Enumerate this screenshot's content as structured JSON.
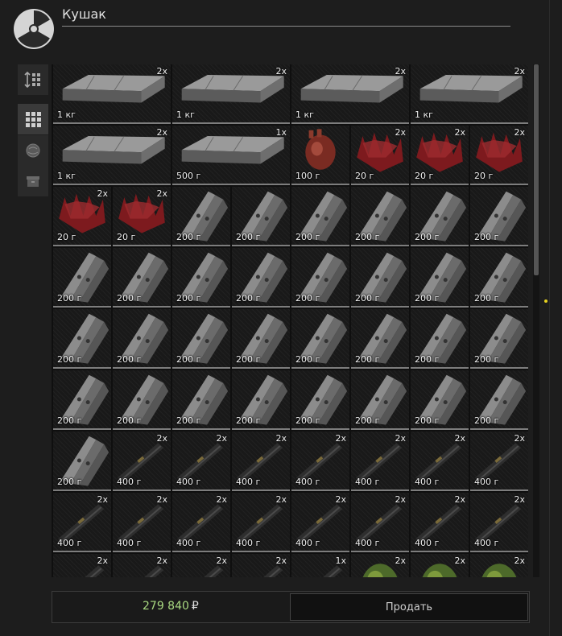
{
  "header": {
    "title": "Кушак",
    "logo_icon": "radiation-icon"
  },
  "sidebar": {
    "tools": [
      {
        "icon": "sort-icon",
        "active": false
      },
      {
        "icon": "grid-view-icon",
        "active": true
      },
      {
        "icon": "artifact-filter-icon",
        "active": false
      },
      {
        "icon": "container-filter-icon",
        "active": false
      }
    ]
  },
  "inventory": {
    "cell_size": [
      {
        "row": 0,
        "items": [
          {
            "type": "crate",
            "span": 2,
            "count": "2x",
            "weight": "1 кг"
          },
          {
            "type": "crate",
            "span": 2,
            "count": "2x",
            "weight": "1 кг"
          },
          {
            "type": "crate",
            "span": 2,
            "count": "2x",
            "weight": "1 кг"
          },
          {
            "type": "crate",
            "span": 2,
            "count": "2x",
            "weight": "1 кг"
          }
        ]
      }
    ],
    "rows": [
      [
        {
          "type": "crate",
          "span": 2,
          "count": "2x",
          "weight": "1 кг"
        },
        {
          "type": "crate",
          "span": 2,
          "count": "2x",
          "weight": "1 кг"
        },
        {
          "type": "crate",
          "span": 2,
          "count": "2x",
          "weight": "1 кг"
        },
        {
          "type": "crate",
          "span": 2,
          "count": "2x",
          "weight": "1 кг"
        }
      ],
      [
        {
          "type": "crate",
          "span": 2,
          "count": "2x",
          "weight": "1 кг"
        },
        {
          "type": "crate",
          "span": 2,
          "count": "1x",
          "weight": "500 г"
        },
        {
          "type": "heart",
          "span": 1,
          "count": "",
          "weight": "100 г"
        },
        {
          "type": "spikes",
          "span": 1,
          "count": "2x",
          "weight": "20 г"
        },
        {
          "type": "spikes",
          "span": 1,
          "count": "2x",
          "weight": "20 г"
        },
        {
          "type": "spikes",
          "span": 1,
          "count": "2x",
          "weight": "20 г"
        }
      ],
      [
        {
          "type": "spikes",
          "span": 1,
          "count": "2x",
          "weight": "20 г"
        },
        {
          "type": "spikes",
          "span": 1,
          "count": "2x",
          "weight": "20 г"
        },
        {
          "type": "plates",
          "span": 1,
          "count": "",
          "weight": "200 г"
        },
        {
          "type": "plates",
          "span": 1,
          "count": "",
          "weight": "200 г"
        },
        {
          "type": "plates",
          "span": 1,
          "count": "",
          "weight": "200 г"
        },
        {
          "type": "plates",
          "span": 1,
          "count": "",
          "weight": "200 г"
        },
        {
          "type": "plates",
          "span": 1,
          "count": "",
          "weight": "200 г"
        },
        {
          "type": "plates",
          "span": 1,
          "count": "",
          "weight": "200 г"
        }
      ],
      [
        {
          "type": "plates",
          "span": 1,
          "count": "",
          "weight": "200 г"
        },
        {
          "type": "plates",
          "span": 1,
          "count": "",
          "weight": "200 г"
        },
        {
          "type": "plates",
          "span": 1,
          "count": "",
          "weight": "200 г"
        },
        {
          "type": "plates",
          "span": 1,
          "count": "",
          "weight": "200 г"
        },
        {
          "type": "plates",
          "span": 1,
          "count": "",
          "weight": "200 г"
        },
        {
          "type": "plates",
          "span": 1,
          "count": "",
          "weight": "200 г"
        },
        {
          "type": "plates",
          "span": 1,
          "count": "",
          "weight": "200 г"
        },
        {
          "type": "plates",
          "span": 1,
          "count": "",
          "weight": "200 г"
        }
      ],
      [
        {
          "type": "plates",
          "span": 1,
          "count": "",
          "weight": "200 г"
        },
        {
          "type": "plates",
          "span": 1,
          "count": "",
          "weight": "200 г"
        },
        {
          "type": "plates",
          "span": 1,
          "count": "",
          "weight": "200 г"
        },
        {
          "type": "plates",
          "span": 1,
          "count": "",
          "weight": "200 г"
        },
        {
          "type": "plates",
          "span": 1,
          "count": "",
          "weight": "200 г"
        },
        {
          "type": "plates",
          "span": 1,
          "count": "",
          "weight": "200 г"
        },
        {
          "type": "plates",
          "span": 1,
          "count": "",
          "weight": "200 г"
        },
        {
          "type": "plates",
          "span": 1,
          "count": "",
          "weight": "200 г"
        }
      ],
      [
        {
          "type": "plates",
          "span": 1,
          "count": "",
          "weight": "200 г"
        },
        {
          "type": "plates",
          "span": 1,
          "count": "",
          "weight": "200 г"
        },
        {
          "type": "plates",
          "span": 1,
          "count": "",
          "weight": "200 г"
        },
        {
          "type": "plates",
          "span": 1,
          "count": "",
          "weight": "200 г"
        },
        {
          "type": "plates",
          "span": 1,
          "count": "",
          "weight": "200 г"
        },
        {
          "type": "plates",
          "span": 1,
          "count": "",
          "weight": "200 г"
        },
        {
          "type": "plates",
          "span": 1,
          "count": "",
          "weight": "200 г"
        },
        {
          "type": "plates",
          "span": 1,
          "count": "",
          "weight": "200 г"
        }
      ],
      [
        {
          "type": "plates",
          "span": 1,
          "count": "",
          "weight": "200 г"
        },
        {
          "type": "bar",
          "span": 1,
          "count": "2x",
          "weight": "400 г"
        },
        {
          "type": "bar",
          "span": 1,
          "count": "2x",
          "weight": "400 г"
        },
        {
          "type": "bar",
          "span": 1,
          "count": "2x",
          "weight": "400 г"
        },
        {
          "type": "bar",
          "span": 1,
          "count": "2x",
          "weight": "400 г"
        },
        {
          "type": "bar",
          "span": 1,
          "count": "2x",
          "weight": "400 г"
        },
        {
          "type": "bar",
          "span": 1,
          "count": "2x",
          "weight": "400 г"
        },
        {
          "type": "bar",
          "span": 1,
          "count": "2x",
          "weight": "400 г"
        }
      ],
      [
        {
          "type": "bar",
          "span": 1,
          "count": "2x",
          "weight": "400 г"
        },
        {
          "type": "bar",
          "span": 1,
          "count": "2x",
          "weight": "400 г"
        },
        {
          "type": "bar",
          "span": 1,
          "count": "2x",
          "weight": "400 г"
        },
        {
          "type": "bar",
          "span": 1,
          "count": "2x",
          "weight": "400 г"
        },
        {
          "type": "bar",
          "span": 1,
          "count": "2x",
          "weight": "400 г"
        },
        {
          "type": "bar",
          "span": 1,
          "count": "2x",
          "weight": "400 г"
        },
        {
          "type": "bar",
          "span": 1,
          "count": "2x",
          "weight": "400 г"
        },
        {
          "type": "bar",
          "span": 1,
          "count": "2x",
          "weight": "400 г"
        }
      ],
      [
        {
          "type": "bar",
          "span": 1,
          "count": "2x",
          "weight": ""
        },
        {
          "type": "bar",
          "span": 1,
          "count": "2x",
          "weight": ""
        },
        {
          "type": "bar",
          "span": 1,
          "count": "2x",
          "weight": ""
        },
        {
          "type": "bar",
          "span": 1,
          "count": "2x",
          "weight": ""
        },
        {
          "type": "bar",
          "span": 1,
          "count": "1x",
          "weight": ""
        },
        {
          "type": "green",
          "span": 1,
          "count": "2x",
          "weight": ""
        },
        {
          "type": "green",
          "span": 1,
          "count": "2x",
          "weight": ""
        },
        {
          "type": "green",
          "span": 1,
          "count": "2x",
          "weight": ""
        }
      ]
    ]
  },
  "footer": {
    "total_price": "279 840",
    "currency": "₽",
    "sell_label": "Продать",
    "price_color": "#a8d980"
  }
}
